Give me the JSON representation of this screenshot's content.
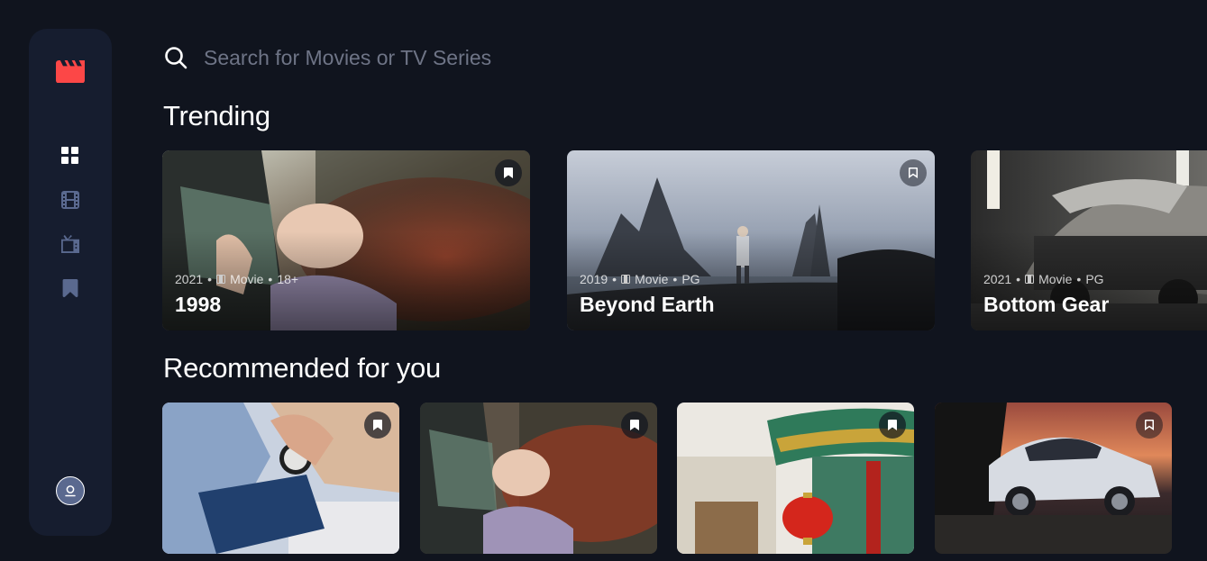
{
  "search": {
    "placeholder": "Search for Movies or TV Series",
    "icon": "search-icon"
  },
  "sidebar": {
    "logo": "clapperboard-icon",
    "accent": "#FC4747",
    "items": [
      {
        "icon": "grid-icon",
        "label": "Home",
        "active": true
      },
      {
        "icon": "film-icon",
        "label": "Movies",
        "active": false
      },
      {
        "icon": "tv-icon",
        "label": "TV Series",
        "active": false
      },
      {
        "icon": "bookmark-icon",
        "label": "Bookmarks",
        "active": false
      }
    ],
    "avatar": "avatar"
  },
  "trending": {
    "title": "Trending",
    "items": [
      {
        "year": "2021",
        "category": "Movie",
        "rating": "18+",
        "title": "1998",
        "bookmarked": true
      },
      {
        "year": "2019",
        "category": "Movie",
        "rating": "PG",
        "title": "Beyond Earth",
        "bookmarked": false
      },
      {
        "year": "2021",
        "category": "Movie",
        "rating": "PG",
        "title": "Bottom Gear",
        "bookmarked": false
      }
    ]
  },
  "recommended": {
    "title": "Recommended for you",
    "items": [
      {
        "bookmarked": true
      },
      {
        "bookmarked": true
      },
      {
        "bookmarked": true
      },
      {
        "bookmarked": false
      }
    ]
  },
  "colors": {
    "background": "#10141E",
    "sidebar": "#161D2F",
    "icon_inactive": "#5A698F",
    "accent_red": "#FC4747"
  }
}
